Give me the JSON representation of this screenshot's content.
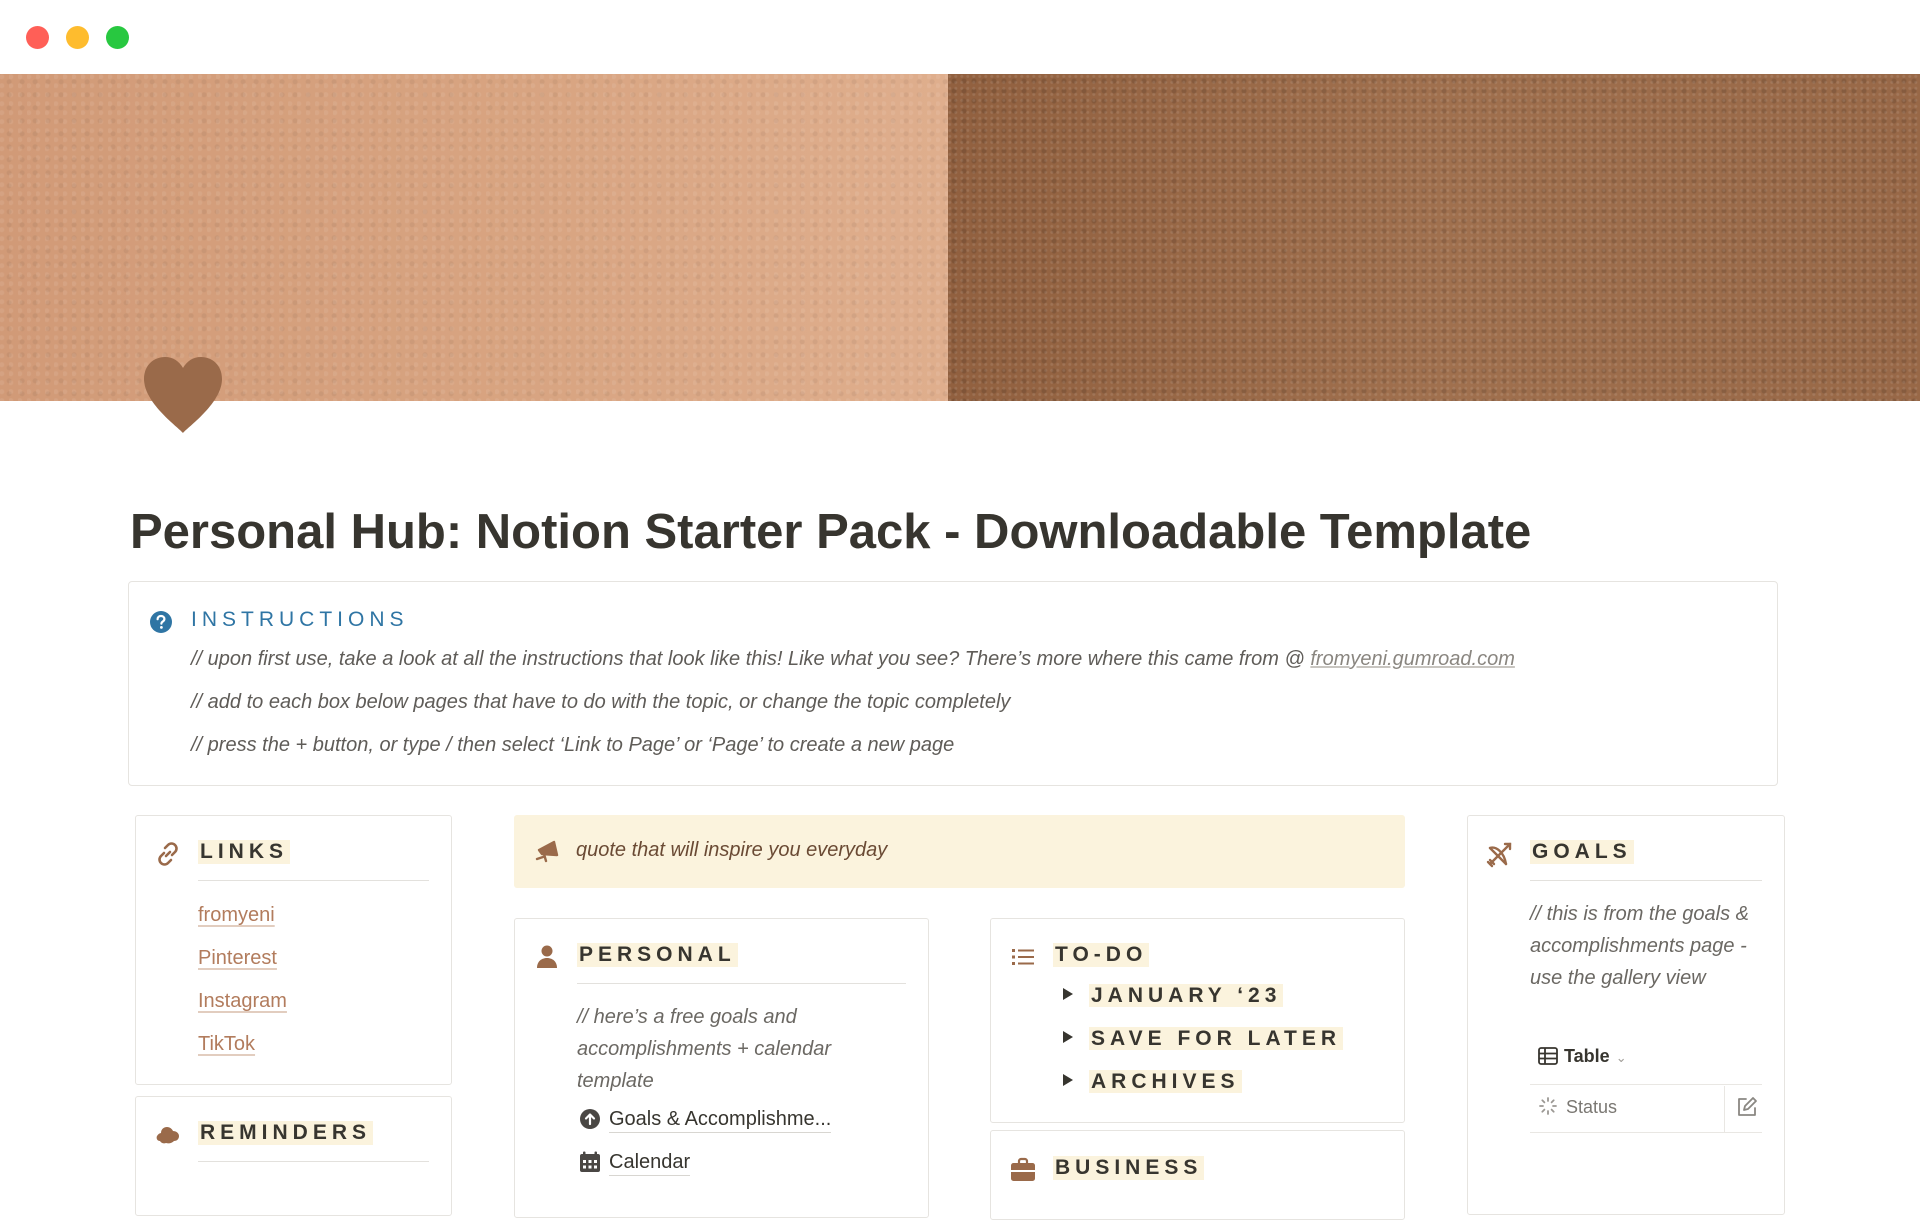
{
  "page": {
    "title": "Personal Hub: Notion Starter Pack - Downloadable Template",
    "icon": "heart-icon"
  },
  "colors": {
    "accent_brown": "#9a6a4a",
    "callout_yellow": "#fbf3dd",
    "instruction_blue": "#2f75a4",
    "link_brown": "#b27c5d"
  },
  "instructions": {
    "heading": "INSTRUCTIONS",
    "line1": "// upon first use, take a look at all the instructions that look like this! Like what you see? There’s more where this came from @ ",
    "line1_link": "fromyeni.gumroad.com",
    "line2": "// add to each box below pages that have to do with the topic, or change the topic completely",
    "line3": "// press the + button, or type / then select ‘Link to Page’ or ‘Page’ to create a new page"
  },
  "links": {
    "heading": "LINKS",
    "items": [
      "fromyeni",
      "Pinterest",
      "Instagram",
      "TikTok"
    ]
  },
  "reminders": {
    "heading": "REMINDERS"
  },
  "quote": {
    "text": "quote that will inspire you everyday"
  },
  "personal": {
    "heading": "PERSONAL",
    "note": "// here’s a free goals and accomplishments + calendar template",
    "pages": [
      "Goals & Accomplishme...",
      "Calendar"
    ]
  },
  "todo": {
    "heading": "TO-DO",
    "toggles": [
      "JANUARY ‘23",
      "SAVE FOR LATER",
      "ARCHIVES"
    ]
  },
  "business": {
    "heading": "BUSINESS"
  },
  "goals": {
    "heading": "GOALS",
    "note": "// this is from the goals & accomplishments page - use the gallery view",
    "view_label": "Table",
    "column_header": "Status"
  }
}
